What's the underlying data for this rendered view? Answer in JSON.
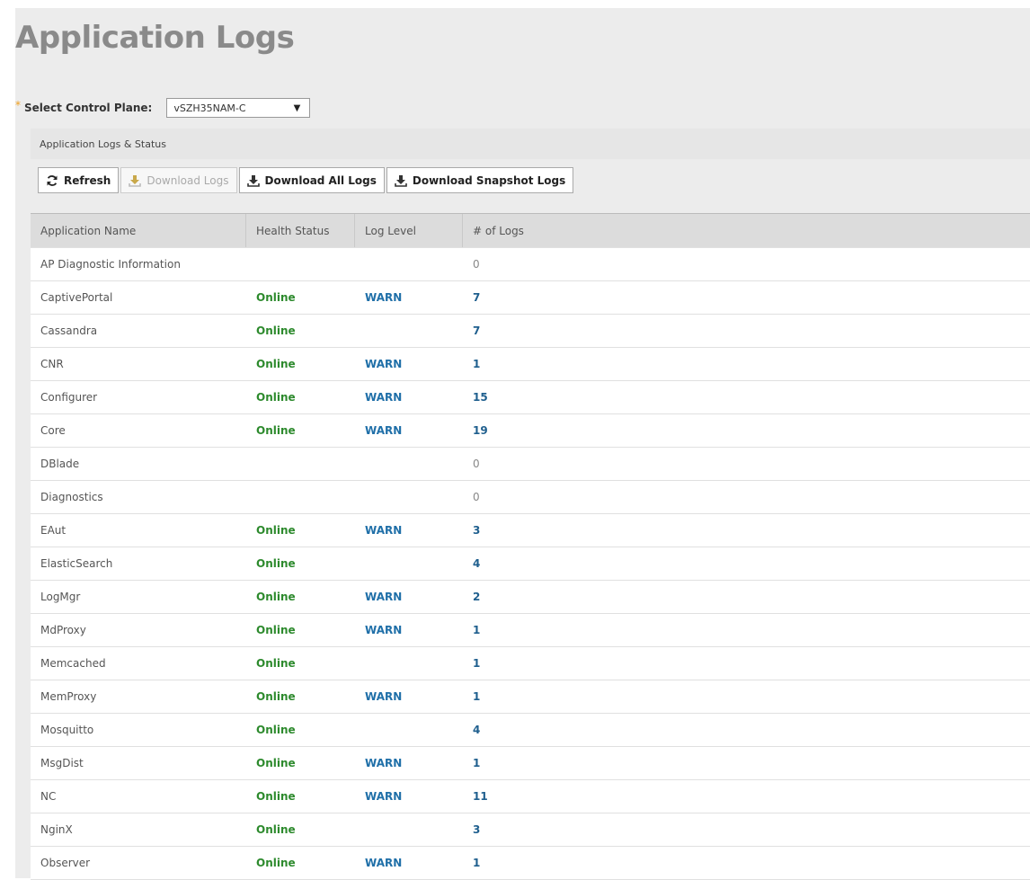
{
  "page": {
    "title": "Application Logs"
  },
  "control_plane": {
    "required_marker": "*",
    "label": "Select Control Plane:",
    "selected": "vSZH35NAM-C"
  },
  "section": {
    "title": "Application Logs & Status"
  },
  "toolbar": {
    "refresh": "Refresh",
    "download_logs": "Download Logs",
    "download_all_logs": "Download All Logs",
    "download_snapshot_logs": "Download Snapshot Logs"
  },
  "table": {
    "headers": [
      "Application Name",
      "Health Status",
      "Log Level",
      "# of Logs"
    ],
    "rows": [
      {
        "name": "AP Diagnostic Information",
        "health": "",
        "level": "",
        "logs": "0"
      },
      {
        "name": "CaptivePortal",
        "health": "Online",
        "level": "WARN",
        "logs": "7"
      },
      {
        "name": "Cassandra",
        "health": "Online",
        "level": "",
        "logs": "7"
      },
      {
        "name": "CNR",
        "health": "Online",
        "level": "WARN",
        "logs": "1"
      },
      {
        "name": "Configurer",
        "health": "Online",
        "level": "WARN",
        "logs": "15"
      },
      {
        "name": "Core",
        "health": "Online",
        "level": "WARN",
        "logs": "19"
      },
      {
        "name": "DBlade",
        "health": "",
        "level": "",
        "logs": "0"
      },
      {
        "name": "Diagnostics",
        "health": "",
        "level": "",
        "logs": "0"
      },
      {
        "name": "EAut",
        "health": "Online",
        "level": "WARN",
        "logs": "3"
      },
      {
        "name": "ElasticSearch",
        "health": "Online",
        "level": "",
        "logs": "4"
      },
      {
        "name": "LogMgr",
        "health": "Online",
        "level": "WARN",
        "logs": "2"
      },
      {
        "name": "MdProxy",
        "health": "Online",
        "level": "WARN",
        "logs": "1"
      },
      {
        "name": "Memcached",
        "health": "Online",
        "level": "",
        "logs": "1"
      },
      {
        "name": "MemProxy",
        "health": "Online",
        "level": "WARN",
        "logs": "1"
      },
      {
        "name": "Mosquitto",
        "health": "Online",
        "level": "",
        "logs": "4"
      },
      {
        "name": "MsgDist",
        "health": "Online",
        "level": "WARN",
        "logs": "1"
      },
      {
        "name": "NC",
        "health": "Online",
        "level": "WARN",
        "logs": "11"
      },
      {
        "name": "NginX",
        "health": "Online",
        "level": "",
        "logs": "3"
      },
      {
        "name": "Observer",
        "health": "Online",
        "level": "WARN",
        "logs": "1"
      }
    ]
  },
  "colors": {
    "online": "#2d8a2d",
    "warn": "#1f6fa8",
    "count": "#1f5f8e",
    "required": "#f0a020"
  },
  "icons": {
    "refresh": "refresh-icon",
    "download": "download-icon",
    "dropdown": "caret-down-icon"
  }
}
